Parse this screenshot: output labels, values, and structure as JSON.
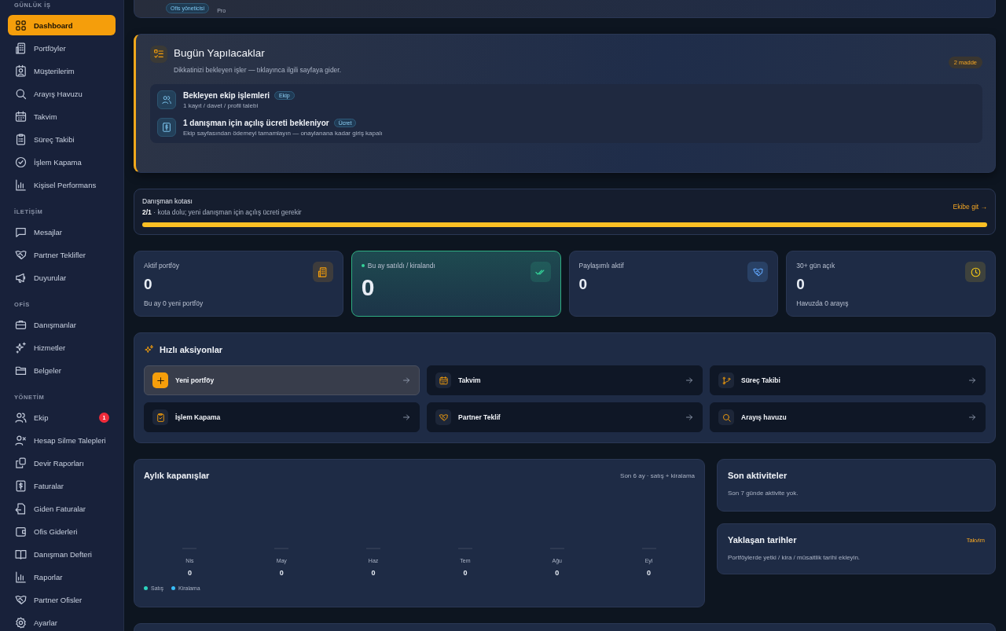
{
  "sidebar": {
    "sections": [
      {
        "label": "GÜNLÜK İŞ",
        "items": [
          {
            "label": "Dashboard",
            "selected": true
          },
          {
            "label": "Portföyler",
            "selected": false
          },
          {
            "label": "Müşterilerim",
            "selected": false
          },
          {
            "label": "Arayış Havuzu",
            "selected": false
          },
          {
            "label": "Takvim",
            "selected": false
          },
          {
            "label": "Süreç Takibi",
            "selected": false
          },
          {
            "label": "İşlem Kapama",
            "selected": false
          },
          {
            "label": "Kişisel Performans",
            "selected": false
          }
        ]
      },
      {
        "label": "İLETİŞİM",
        "items": [
          {
            "label": "Mesajlar",
            "selected": false
          },
          {
            "label": "Partner Teklifler",
            "selected": false
          },
          {
            "label": "Duyurular",
            "selected": false
          }
        ]
      },
      {
        "label": "OFİS",
        "items": [
          {
            "label": "Danışmanlar",
            "selected": false
          },
          {
            "label": "Hizmetler",
            "selected": false
          },
          {
            "label": "Belgeler",
            "selected": false
          }
        ]
      },
      {
        "label": "YÖNETİM",
        "items": [
          {
            "label": "Ekip",
            "selected": false,
            "badge": "1"
          },
          {
            "label": "Hesap Silme Talepleri",
            "selected": false
          },
          {
            "label": "Devir Raporları",
            "selected": false
          },
          {
            "label": "Faturalar",
            "selected": false
          },
          {
            "label": "Giden Faturalar",
            "selected": false
          },
          {
            "label": "Ofis Giderleri",
            "selected": false
          },
          {
            "label": "Danışman Defteri",
            "selected": false
          },
          {
            "label": "Raporlar",
            "selected": false
          },
          {
            "label": "Partner Ofisler",
            "selected": false
          },
          {
            "label": "Ayarlar",
            "selected": false
          }
        ]
      }
    ]
  },
  "profile": {
    "role": "Ofis yöneticisi",
    "plan": "Pro"
  },
  "todo": {
    "title": "Bugün Yapılacaklar",
    "subtitle": "Dikkatinizi bekleyen işler — tıklayınca ilgili sayfaya gider.",
    "count": "2 madde",
    "items": [
      {
        "title": "Bekleyen ekip işlemleri",
        "tag": "Ekip",
        "detail": "1 kayıt / davet / profil talebi"
      },
      {
        "title": "1 danışman için açılış ücreti bekleniyor",
        "tag": "Ücret",
        "detail": "Ekip sayfasından ödemeyi tamamlayın — onaylanana kadar giriş kapalı"
      }
    ]
  },
  "quota": {
    "title": "Danışman kotası",
    "text": "**2/1** · kota dolu; yeni danışman için açılış ücreti gerekir",
    "link": "Ekibe git →",
    "level": 1
  },
  "stats": [
    {
      "label": "Aktif portföy",
      "value": "0",
      "note": "Bu ay 0 yeni portföy",
      "highlighted": false
    },
    {
      "label": "Bu ay satıldı / kiralandı",
      "value": "0",
      "highlighted": true
    },
    {
      "label": "Paylaşımlı aktif",
      "value": "0",
      "highlighted": false
    },
    {
      "label": "30+ gün açık",
      "value": "0",
      "note": "Havuzda 0 arayış",
      "highlighted": false
    }
  ],
  "quick_actions": {
    "title": "Hızlı aksiyonlar",
    "items": [
      {
        "label": "Yeni portföy",
        "highlighted": true
      },
      {
        "label": "Takvim",
        "highlighted": false
      },
      {
        "label": "Süreç Takibi",
        "highlighted": false
      },
      {
        "label": "İşlem Kapama",
        "highlighted": false
      },
      {
        "label": "Partner Teklif",
        "highlighted": false
      },
      {
        "label": "Arayış havuzu",
        "highlighted": false
      }
    ]
  },
  "monthly": {
    "title": "Aylık kapanışlar",
    "caption": "Son 6 ay · satış + kiralama",
    "months": [
      {
        "label": "Nis",
        "value": "0"
      },
      {
        "label": "May",
        "value": "0"
      },
      {
        "label": "Haz",
        "value": "0"
      },
      {
        "label": "Tem",
        "value": "0"
      },
      {
        "label": "Ağu",
        "value": "0"
      },
      {
        "label": "Eyl",
        "value": "0"
      }
    ],
    "legend": [
      {
        "label": "Satış",
        "color": "#2dd4bf"
      },
      {
        "label": "Kiralama",
        "color": "#38bdf8"
      }
    ]
  },
  "recent": {
    "title": "Son aktiviteler",
    "empty": "Son 7 günde aktivite yok."
  },
  "upcoming": {
    "title": "Yaklaşan tarihler",
    "link": "Takvim",
    "empty": "Portföylerde yetki / kira / müsaitlik tarihi ekleyin."
  }
}
